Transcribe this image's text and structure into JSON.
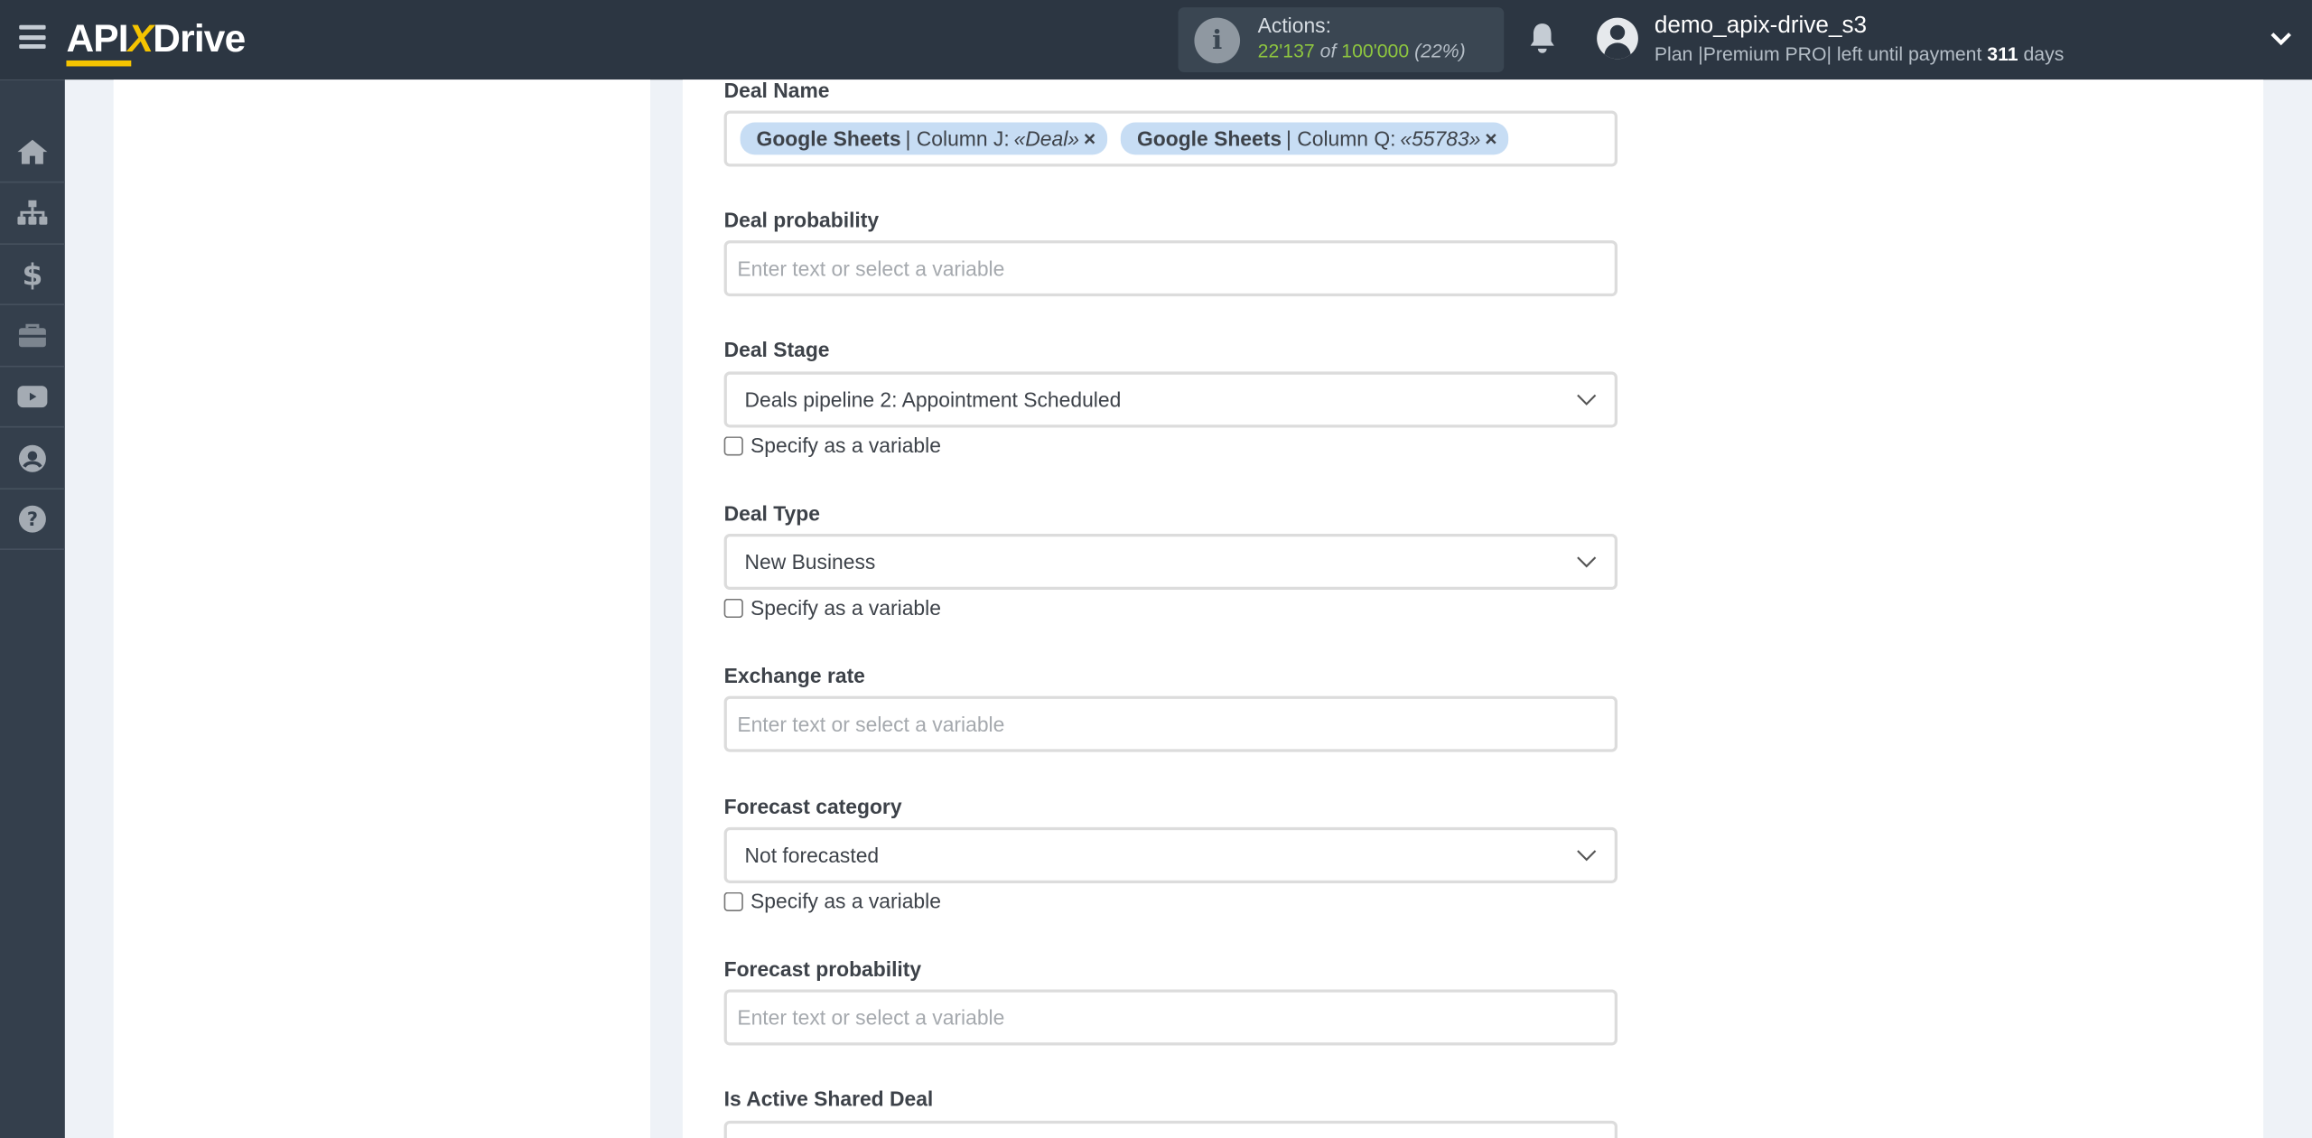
{
  "header": {
    "logo": "APIXDrive",
    "actions_label": "Actions:",
    "actions_used": "22'137",
    "actions_of": "of",
    "actions_total": "100'000",
    "actions_percent": "(22%)",
    "actions_fraction": 0.22,
    "username": "demo_apix-drive_s3",
    "plan_prefix": "Plan |Premium PRO| left until payment",
    "plan_days": "311",
    "plan_suffix": "days"
  },
  "sidebar": {
    "items": [
      {
        "icon": "home-icon"
      },
      {
        "icon": "sitemap-icon"
      },
      {
        "icon": "dollar-icon"
      },
      {
        "icon": "briefcase-icon"
      },
      {
        "icon": "youtube-icon"
      },
      {
        "icon": "user-circle-icon"
      },
      {
        "icon": "question-circle-icon"
      }
    ]
  },
  "form": {
    "deal_name": {
      "label": "Deal Name",
      "tags": [
        {
          "source": "Google Sheets",
          "column": "| Column J:",
          "value": "«Deal»",
          "remove": "×"
        },
        {
          "source": "Google Sheets",
          "column": "| Column Q:",
          "value": "«55783»",
          "remove": "×"
        }
      ]
    },
    "deal_probability": {
      "label": "Deal probability",
      "placeholder": "Enter text or select a variable"
    },
    "deal_stage": {
      "label": "Deal Stage",
      "value": "Deals pipeline 2: Appointment Scheduled",
      "checkbox": "Specify as a variable"
    },
    "deal_type": {
      "label": "Deal Type",
      "value": "New Business",
      "checkbox": "Specify as a variable"
    },
    "exchange_rate": {
      "label": "Exchange rate",
      "placeholder": "Enter text or select a variable"
    },
    "forecast_category": {
      "label": "Forecast category",
      "value": "Not forecasted",
      "checkbox": "Specify as a variable"
    },
    "forecast_probability": {
      "label": "Forecast probability",
      "placeholder": "Enter text or select a variable"
    },
    "is_active_shared_deal": {
      "label": "Is Active Shared Deal"
    }
  },
  "colors": {
    "header_bg": "#2c3642",
    "sidebar_bg": "#343f4c",
    "accent_yellow": "#f5c400",
    "actions_green": "#8ec63f",
    "tag_bg": "#c7ddf4"
  }
}
